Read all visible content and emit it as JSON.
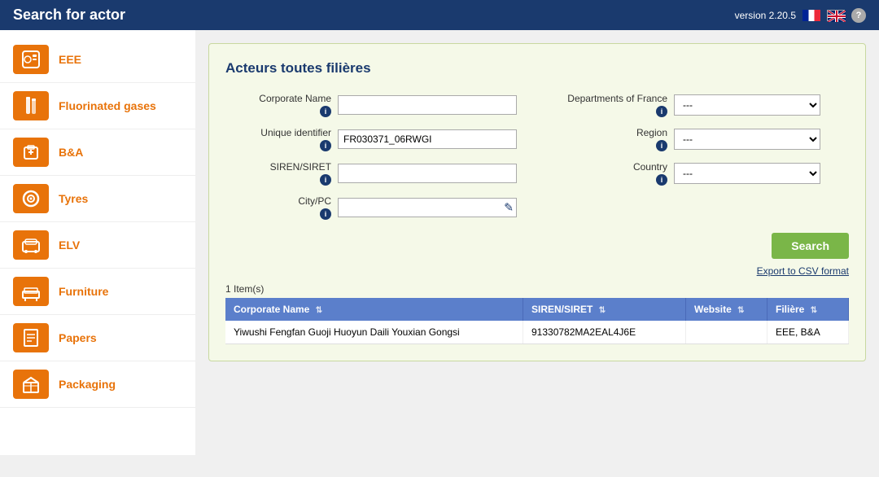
{
  "header": {
    "title": "Search for actor",
    "version": "version 2.20.5",
    "help_label": "?"
  },
  "sidebar": {
    "items": [
      {
        "id": "eee",
        "label": "EEE",
        "icon": "washing-machine"
      },
      {
        "id": "fluorinated",
        "label": "Fluorinated gases",
        "icon": "gas-cylinder"
      },
      {
        "id": "bna",
        "label": "B&A",
        "icon": "battery"
      },
      {
        "id": "tyres",
        "label": "Tyres",
        "icon": "tyre"
      },
      {
        "id": "elv",
        "label": "ELV",
        "icon": "car-seat"
      },
      {
        "id": "furniture",
        "label": "Furniture",
        "icon": "furniture"
      },
      {
        "id": "papers",
        "label": "Papers",
        "icon": "papers"
      },
      {
        "id": "packaging",
        "label": "Packaging",
        "icon": "packaging"
      }
    ]
  },
  "content": {
    "section_title": "Acteurs toutes filières",
    "form": {
      "corporate_name_label": "Corporate Name",
      "unique_identifier_label": "Unique identifier",
      "siren_siret_label": "SIREN/SIRET",
      "city_pc_label": "City/PC",
      "departments_label": "Departments of France",
      "region_label": "Region",
      "country_label": "Country",
      "unique_identifier_value": "FR030371_06RWGI",
      "departments_value": "---",
      "region_value": "---",
      "country_value": "---",
      "search_button": "Search",
      "export_link": "Export to CSV format"
    },
    "table": {
      "item_count": "1 Item(s)",
      "columns": [
        {
          "key": "corporate_name",
          "label": "Corporate Name",
          "sortable": true
        },
        {
          "key": "siren_siret",
          "label": "SIREN/SIRET",
          "sortable": true
        },
        {
          "key": "website",
          "label": "Website",
          "sortable": true
        },
        {
          "key": "filiere",
          "label": "Filière",
          "sortable": true
        }
      ],
      "rows": [
        {
          "corporate_name": "Yiwushi Fengfan Guoji Huoyun Daili Youxian Gongsi",
          "siren_siret": "91330782MA2EAL4J6E",
          "website": "",
          "filiere": "EEE, B&A"
        }
      ]
    }
  }
}
